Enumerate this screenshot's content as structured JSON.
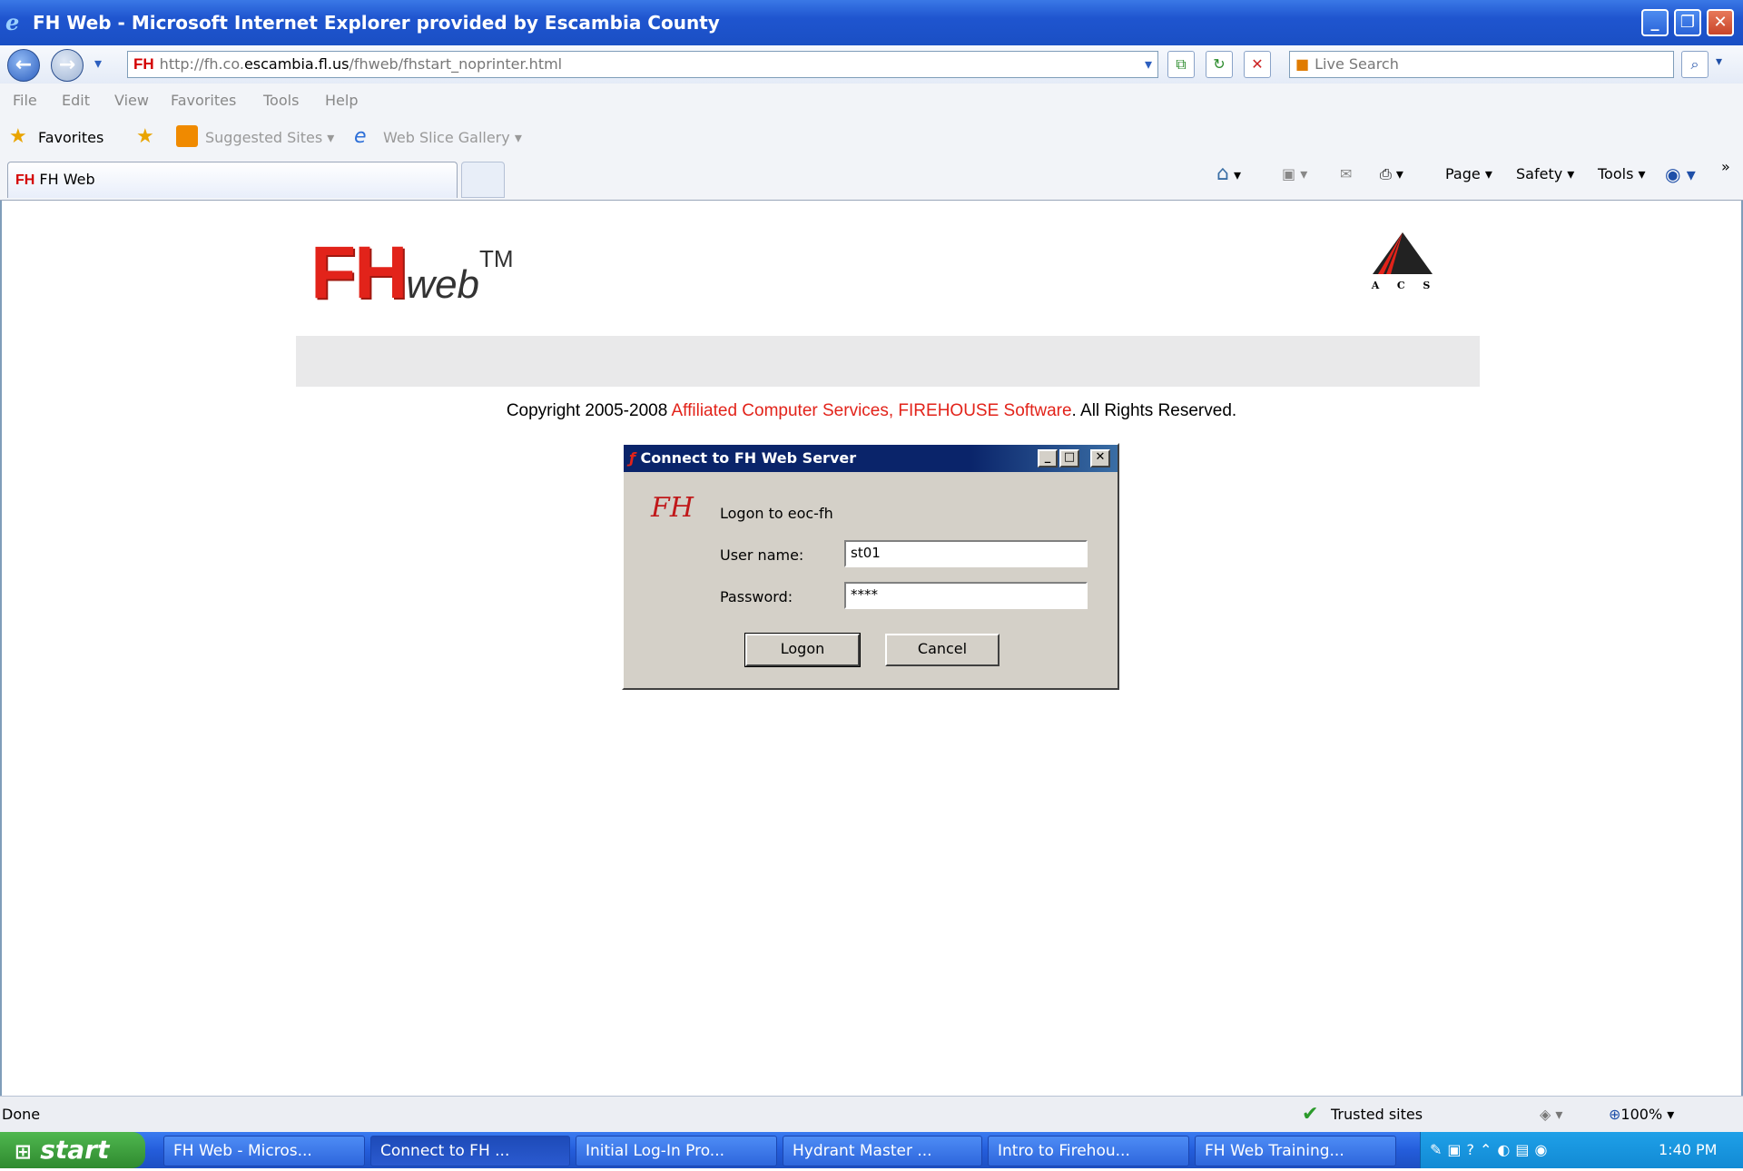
{
  "window": {
    "title": "FH Web - Microsoft Internet Explorer provided by Escambia County",
    "ie_icon": "e",
    "minimize": "_",
    "restore": "❐",
    "close": "✕"
  },
  "address_bar": {
    "back": "←",
    "forward": "→",
    "dropdown": "▾",
    "url_icon_text": "FH",
    "url_prefix": "http://fh.co.",
    "url_host": "escambia.fl.us",
    "url_path": "/fhweb/fhstart_noprinter.html",
    "search_placeholder": "Live Search",
    "search_button": "⌕"
  },
  "menu": [
    "File",
    "Edit",
    "View",
    "Favorites",
    "Tools",
    "Help"
  ],
  "favorites_bar": {
    "favorites": "Favorites",
    "suggested_sites": "Suggested Sites ▾",
    "web_slice_gallery": "Web Slice Gallery ▾"
  },
  "tab": {
    "icon_text": "FH",
    "label": "FH Web"
  },
  "command_bar": {
    "page": "Page ▾",
    "safety": "Safety ▾",
    "tools": "Tools ▾",
    "more": "»"
  },
  "page": {
    "logo_fh": "FH",
    "logo_web": "web",
    "logo_tm": "TM",
    "acs_letters": "A  C  S",
    "copyright_prefix": "Copyright 2005-2008 ",
    "copyright_link": "Affiliated Computer Services, FIREHOUSE Software",
    "copyright_suffix": ". All Rights Reserved."
  },
  "dialog": {
    "title": "Connect to FH Web Server",
    "logon_to": "Logon to eoc-fh",
    "username_label": "User name:",
    "username_value": "st01",
    "password_label": "Password:",
    "password_value": "****",
    "logon_button": "Logon",
    "cancel_button": "Cancel"
  },
  "status_bar": {
    "status": "Done",
    "zone": "Trusted sites",
    "zoom": "100%"
  },
  "taskbar": {
    "start": "start",
    "items": [
      "FH Web - Micros...",
      "Connect to FH ...",
      "Initial Log-In Pro...",
      "Hydrant Master ...",
      "Intro to Firehou...",
      "FH Web Training..."
    ],
    "clock": "1:40 PM"
  },
  "colors": {
    "title_bar": "#1f55cf",
    "dialog_title": "#0a246a",
    "brand_red": "#e2231a",
    "taskbar": "#245ddb",
    "start_green": "#2f8a2f"
  }
}
